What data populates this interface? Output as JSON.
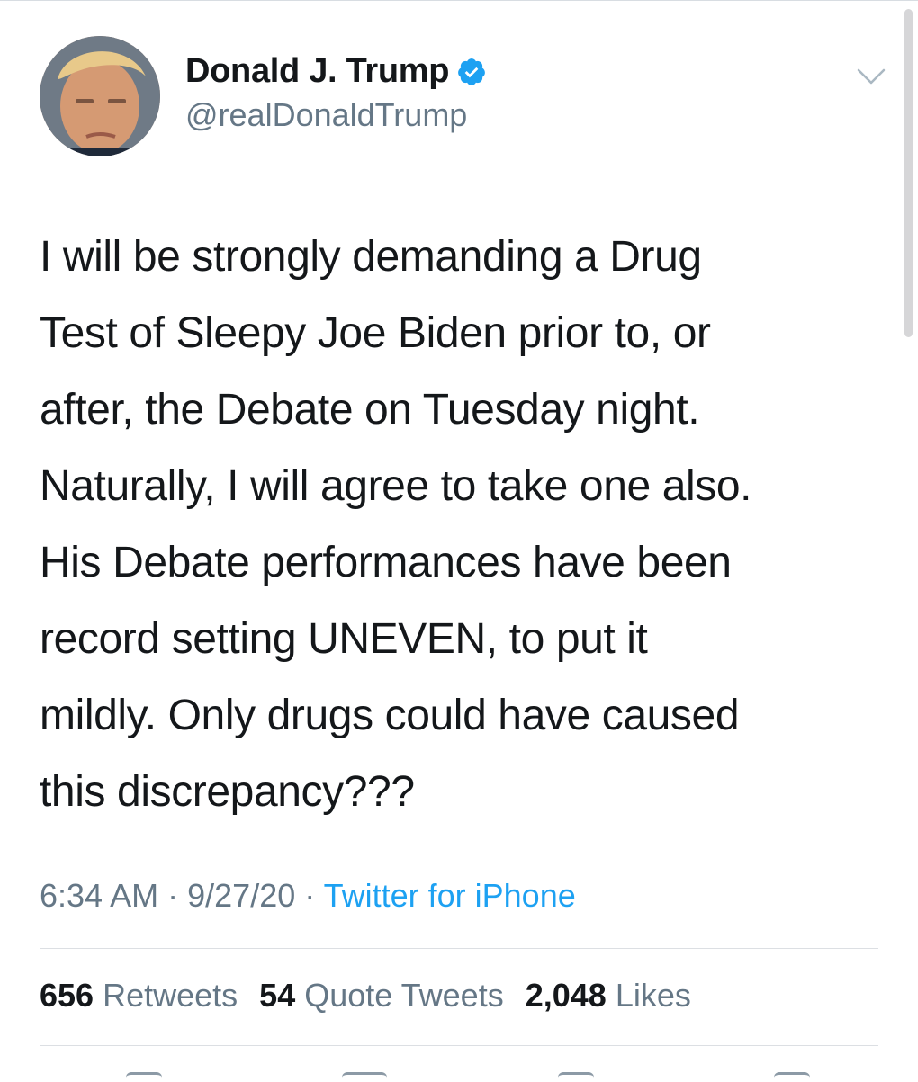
{
  "user": {
    "display_name": "Donald J. Trump",
    "handle": "@realDonaldTrump",
    "verified": true,
    "verified_color": "#1da1f2"
  },
  "tweet": {
    "text": "I will be strongly demanding a Drug\nTest of Sleepy Joe Biden prior to, or\nafter, the Debate on Tuesday night.\nNaturally, I will agree to take one also.\nHis Debate performances have been\nrecord setting UNEVEN, to put it\nmildly. Only drugs could have caused\nthis discrepancy???",
    "time": "6:34 AM",
    "separator": "·",
    "date": "9/27/20",
    "source": "Twitter for iPhone"
  },
  "stats": {
    "retweets_count": "656",
    "retweets_label": "Retweets",
    "quotes_count": "54",
    "quotes_label": "Quote Tweets",
    "likes_count": "2,048",
    "likes_label": "Likes"
  },
  "icons": {
    "verified": "verified-badge-icon",
    "menu": "chevron-down-icon",
    "actions": [
      "reply-icon",
      "retweet-icon",
      "like-icon",
      "share-icon"
    ]
  },
  "colors": {
    "text": "#14171a",
    "secondary": "#657786",
    "link": "#1da1f2",
    "divider": "#dcdfe3"
  }
}
